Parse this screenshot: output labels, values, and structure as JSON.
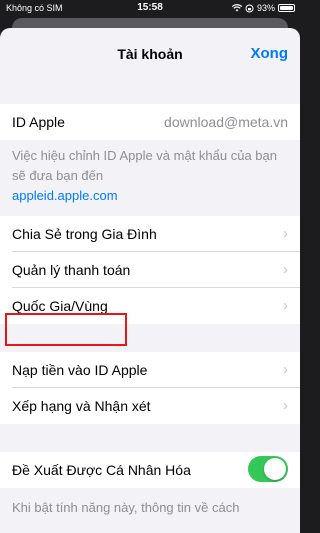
{
  "status_bar": {
    "carrier": "Không có SIM",
    "time": "15:58",
    "battery": "93%",
    "icons": [
      "wifi-icon",
      "rotation-lock-icon",
      "battery-icon"
    ]
  },
  "navbar": {
    "title": "Tài khoản",
    "done": "Xong"
  },
  "apple_id": {
    "label": "ID Apple",
    "value": "download@meta.vn",
    "note": "Việc hiệu chỉnh ID Apple và mật khẩu của bạn sẽ đưa bạn đến",
    "link": "appleid.apple.com"
  },
  "group1": [
    {
      "label": "Chia Sẻ trong Gia Đình"
    },
    {
      "label": "Quản lý thanh toán"
    },
    {
      "label": "Quốc Gia/Vùng"
    }
  ],
  "group2": [
    {
      "label": "Nạp tiền vào ID Apple"
    },
    {
      "label": "Xếp hạng và Nhận xét"
    }
  ],
  "personalization": {
    "label": "Đề Xuất Được Cá Nhân Hóa",
    "toggle_on": true,
    "footer": "Khi bật tính năng này, thông tin về cách"
  },
  "colors": {
    "accent": "#007aff",
    "toggle": "#34c759",
    "highlight": "#e8161b"
  }
}
